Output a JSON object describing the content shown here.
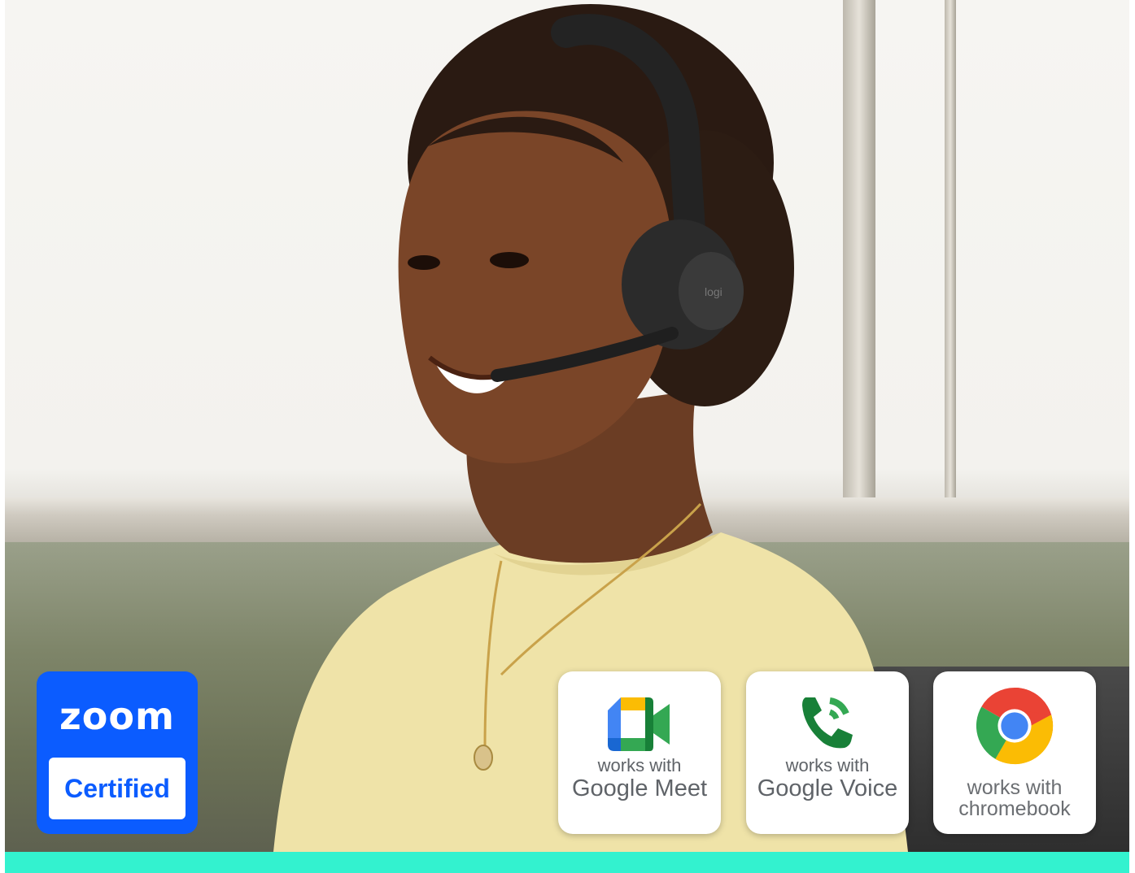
{
  "badges": {
    "zoom": {
      "logo_text": "zoom",
      "certified": "Certified"
    },
    "meet": {
      "small": "works with",
      "big": "Google Meet"
    },
    "voice": {
      "small": "works with",
      "big": "Google Voice"
    },
    "chromebook": {
      "line1": "works with",
      "line2": "chromebook"
    }
  },
  "colors": {
    "zoom_blue": "#0b5cff",
    "bottom_bar": "#33f2cf",
    "chrome_red": "#ea4335",
    "chrome_yellow": "#fbbc04",
    "chrome_green": "#34a853",
    "chrome_blue": "#4285f4"
  },
  "headset_logo": "logi"
}
